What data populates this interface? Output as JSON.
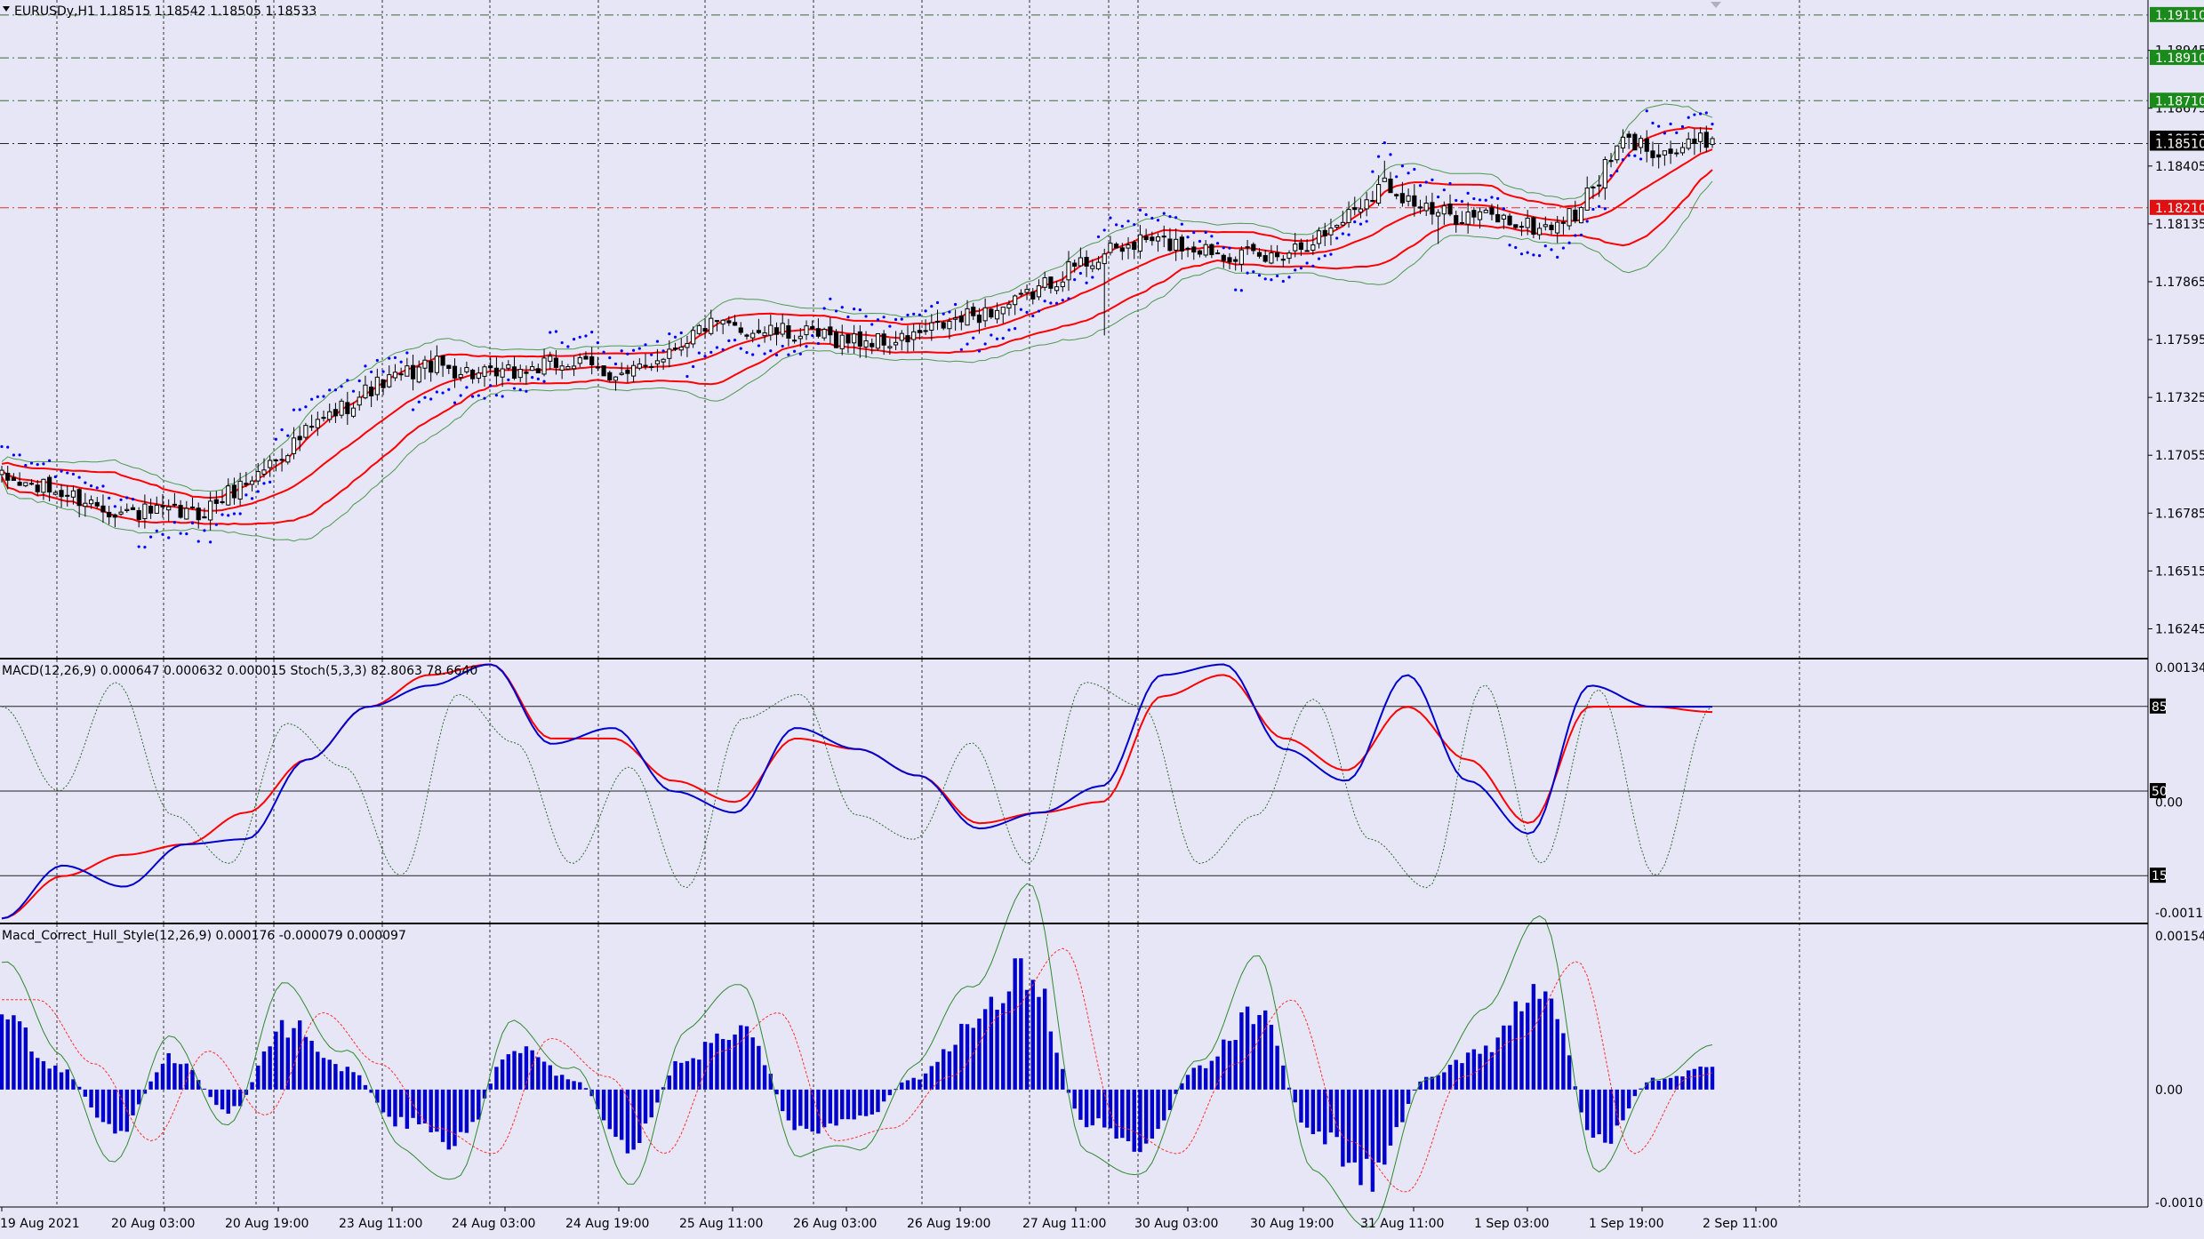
{
  "header": {
    "symbol_info": "EURUSDy,H1  1.18515 1.18542 1.18505 1.18533",
    "macd_stoch_title": "MACD(12,26,9) 0.000647 0.000632 0.000015  Stoch(5,3,3) 82.8063 78.6640",
    "hull_title": "Macd_Correct_Hull_Style(12,26,9) 0.000176 -0.000079 0.000097"
  },
  "price_axis": {
    "ticks": [
      "1.18945",
      "1.18675",
      "1.18405",
      "1.18135",
      "1.17865",
      "1.17595",
      "1.17325",
      "1.17055",
      "1.16785",
      "1.16515",
      "1.16245"
    ],
    "levels": [
      {
        "label": "1.19110",
        "value": 1.1911,
        "bg": "#1a8a1a",
        "fg": "#ffffff",
        "style": "dashdot",
        "line": "#3a6a3a"
      },
      {
        "label": "1.18910",
        "value": 1.1891,
        "bg": "#1a8a1a",
        "fg": "#ffffff",
        "style": "dashdot",
        "line": "#3a6a3a"
      },
      {
        "label": "1.18710",
        "value": 1.1871,
        "bg": "#1a8a1a",
        "fg": "#ffffff",
        "style": "dashdot",
        "line": "#3a6a3a"
      },
      {
        "label": "1.18533",
        "value": 1.18533,
        "bg": "#000000",
        "fg": "#ffffff",
        "style": "none",
        "line": "#000000"
      },
      {
        "label": "1.18510",
        "value": 1.1851,
        "bg": "#000000",
        "fg": "#ffffff",
        "style": "dashdot",
        "line": "#222222"
      },
      {
        "label": "1.18210",
        "value": 1.1821,
        "bg": "#e01010",
        "fg": "#ffffff",
        "style": "dashdot",
        "line": "#e03030"
      }
    ]
  },
  "macd_axis": {
    "top": "0.001346",
    "zero": "0.00",
    "bottom": "-0.001139",
    "stoch_levels": [
      "85",
      "50",
      "15"
    ]
  },
  "hull_axis": {
    "top": "0.001545",
    "zero": "0.00",
    "bottom": "-0.00109"
  },
  "time_axis": [
    "19 Aug 2021",
    "20 Aug 03:00",
    "20 Aug 19:00",
    "23 Aug 11:00",
    "24 Aug 03:00",
    "24 Aug 19:00",
    "25 Aug 11:00",
    "26 Aug 03:00",
    "26 Aug 19:00",
    "27 Aug 11:00",
    "30 Aug 03:00",
    "30 Aug 19:00",
    "31 Aug 11:00",
    "1 Sep 03:00",
    "1 Sep 19:00",
    "2 Sep 11:00"
  ],
  "colors": {
    "background": "#e6e6f7",
    "bollinger_mid": "#ff0000",
    "bollinger_outer": "#4c9a4c",
    "sar": "#0000ff",
    "macd_main": "#0000cc",
    "macd_signal": "#ff0000",
    "stoch": "#2e6b2e",
    "hull_hist": "#0000cc",
    "hull_line": "#2e8b2e",
    "hull_signal": "#ff3030"
  },
  "chart_data": {
    "type": "candlestick",
    "symbol": "EURUSDy",
    "timeframe": "H1",
    "ylim": [
      1.1611,
      1.1918
    ],
    "close_path_anchors": [
      {
        "bar": 0,
        "close": 1.16945
      },
      {
        "bar": 10,
        "close": 1.1688
      },
      {
        "bar": 20,
        "close": 1.1679
      },
      {
        "bar": 25,
        "close": 1.16785
      },
      {
        "bar": 33,
        "close": 1.1678
      },
      {
        "bar": 42,
        "close": 1.1695
      },
      {
        "bar": 52,
        "close": 1.1718
      },
      {
        "bar": 62,
        "close": 1.1737
      },
      {
        "bar": 72,
        "close": 1.1748
      },
      {
        "bar": 82,
        "close": 1.1742
      },
      {
        "bar": 95,
        "close": 1.1749
      },
      {
        "bar": 105,
        "close": 1.1742
      },
      {
        "bar": 118,
        "close": 1.1766
      },
      {
        "bar": 130,
        "close": 1.1763
      },
      {
        "bar": 140,
        "close": 1.176
      },
      {
        "bar": 150,
        "close": 1.1758
      },
      {
        "bar": 162,
        "close": 1.177
      },
      {
        "bar": 170,
        "close": 1.1776
      },
      {
        "bar": 180,
        "close": 1.1794
      },
      {
        "bar": 192,
        "close": 1.1806
      },
      {
        "bar": 202,
        "close": 1.1802
      },
      {
        "bar": 212,
        "close": 1.1797
      },
      {
        "bar": 222,
        "close": 1.1809
      },
      {
        "bar": 232,
        "close": 1.1833
      },
      {
        "bar": 240,
        "close": 1.1818
      },
      {
        "bar": 250,
        "close": 1.1817
      },
      {
        "bar": 258,
        "close": 1.1811
      },
      {
        "bar": 264,
        "close": 1.1818
      },
      {
        "bar": 272,
        "close": 1.1852
      },
      {
        "bar": 280,
        "close": 1.1847
      },
      {
        "bar": 287,
        "close": 1.18533
      }
    ],
    "macd_main": [
      -0.0011,
      -0.0006,
      -0.0008,
      -0.0004,
      -0.00035,
      0.0004,
      0.0009,
      0.0011,
      0.0013,
      0.00055,
      0.0007,
      0.0001,
      -0.0001,
      0.0007,
      0.0005,
      0.00025,
      -0.00025,
      -0.0001,
      0.00015,
      0.0012,
      0.0013,
      0.0005,
      0.0002,
      0.0012,
      0.0002,
      -0.0003,
      0.0011,
      0.0009,
      0.0009
    ],
    "macd_signal": [
      -0.0011,
      -0.0007,
      -0.0005,
      -0.0004,
      -0.0001,
      0.0004,
      0.0009,
      0.0012,
      0.0013,
      0.0006,
      0.0006,
      0.0002,
      0.0,
      0.0006,
      0.0005,
      0.00025,
      -0.0002,
      -0.0001,
      0.0,
      0.001,
      0.0012,
      0.0006,
      0.0003,
      0.0009,
      0.0004,
      -0.0002,
      0.0009,
      0.0009,
      0.00085
    ],
    "stoch": [
      85,
      50,
      95,
      40,
      20,
      78,
      60,
      15,
      90,
      70,
      20,
      60,
      10,
      80,
      90,
      40,
      30,
      70,
      20,
      95,
      85,
      20,
      40,
      88,
      30,
      10,
      94,
      20,
      92,
      15,
      85
    ],
    "hull_hist_profile": [
      0.0007,
      0.0002,
      -0.0004,
      0.0003,
      -0.0002,
      0.0006,
      0.0002,
      -0.0003,
      -0.0005,
      0.0004,
      0.0001,
      -0.0005,
      0.0003,
      0.0006,
      -0.0004,
      -0.0003,
      0.0001,
      0.0006,
      0.0011,
      -0.0003,
      -0.0005,
      0.0002,
      0.0007,
      -0.0004,
      -0.0008,
      0.0001,
      0.0004,
      0.001,
      -0.0005,
      0.0001,
      0.0002
    ]
  }
}
